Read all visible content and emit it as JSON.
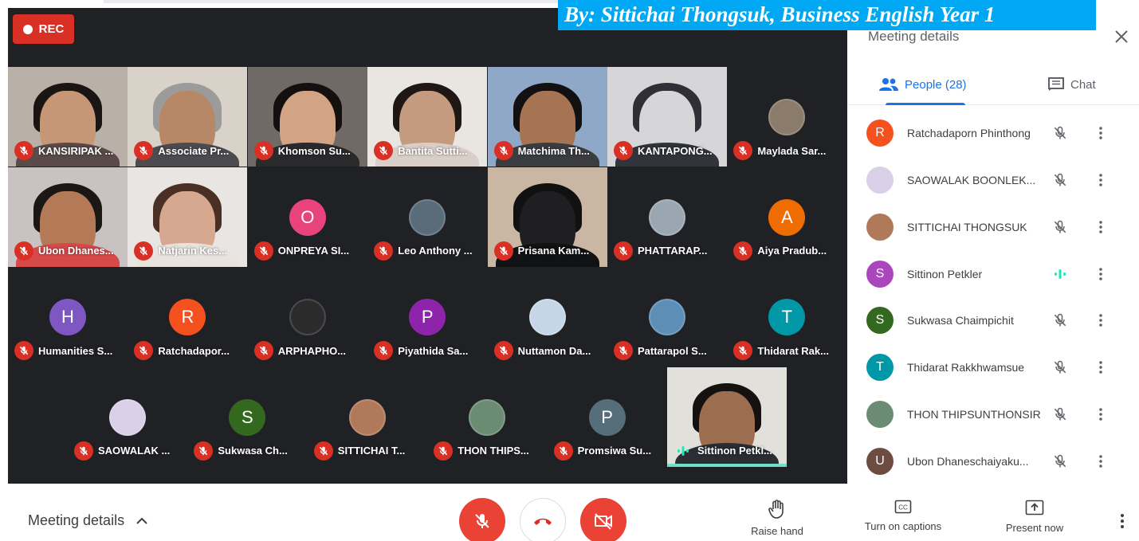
{
  "watermark": "By: Sittichai Thongsuk, Business English Year 1",
  "recording": {
    "label": "REC",
    "color": "#d93025"
  },
  "tiles": [
    {
      "name": "KANSIRIPAK ...",
      "kind": "video",
      "bg": "#b9b0a8",
      "skin": "#c59776",
      "hair": "#1a1412",
      "shirt": "#5a4a4a"
    },
    {
      "name": "Associate Pr...",
      "kind": "video",
      "bg": "#d8d2c8",
      "skin": "#b68868",
      "hair": "#9b9b9b",
      "shirt": "#4b4b50"
    },
    {
      "name": "Khomson Su...",
      "kind": "video",
      "bg": "#6f6a66",
      "skin": "#d2a384",
      "hair": "#151010",
      "shirt": "#2a2a2c"
    },
    {
      "name": "Bantita Sutti...",
      "kind": "video",
      "bg": "#e9e6e1",
      "skin": "#c59b7f",
      "hair": "#1f1713",
      "shirt": "#d9cfc8"
    },
    {
      "name": "Matchima Th...",
      "kind": "video",
      "bg": "#8fa8c8",
      "skin": "#a77453",
      "hair": "#121010",
      "shirt": "#3b3c40"
    },
    {
      "name": "KANTAPONG...",
      "kind": "video",
      "bg": "#d6d6d9",
      "skin": "#d6d6d9",
      "hair": "#2e3036",
      "shirt": "#31343b"
    },
    {
      "name": "Maylada Sar...",
      "kind": "avatar",
      "letter": "",
      "color": "#8a7b6a"
    },
    {
      "name": "Ubon Dhanes...",
      "kind": "video",
      "bg": "#c9c2c3",
      "skin": "#b47a58",
      "hair": "#1b1715",
      "shirt": "#d74a4a"
    },
    {
      "name": "Natjarin Kes...",
      "kind": "video",
      "bg": "#e8e5e3",
      "skin": "#d7a890",
      "hair": "#4a3024",
      "shirt": "#e9e3de"
    },
    {
      "name": "ONPREYA SI...",
      "kind": "avatar",
      "letter": "O",
      "color": "#e8437a"
    },
    {
      "name": "Leo Anthony ...",
      "kind": "avatar",
      "letter": "",
      "color": "#5a6b7a"
    },
    {
      "name": "Prisana Kam...",
      "kind": "video",
      "bg": "#c9b7a4",
      "skin": "#1f1f22",
      "hair": "#111",
      "shirt": "#111214"
    },
    {
      "name": "PHATTARAP...",
      "kind": "avatar",
      "letter": "",
      "color": "#9aa7b2"
    },
    {
      "name": "Aiya Pradub...",
      "kind": "avatar",
      "letter": "A",
      "color": "#ef6c00"
    },
    {
      "name": "Humanities S...",
      "kind": "avatar",
      "letter": "H",
      "color": "#7e57c2"
    },
    {
      "name": "Ratchadapor...",
      "kind": "avatar",
      "letter": "R",
      "color": "#f4511e"
    },
    {
      "name": "ARPHAPHO...",
      "kind": "avatar",
      "letter": "",
      "color": "#2b2b2b"
    },
    {
      "name": "Piyathida Sa...",
      "kind": "avatar",
      "letter": "P",
      "color": "#8e24aa"
    },
    {
      "name": "Nuttamon Da...",
      "kind": "avatar",
      "letter": "",
      "color": "#c7d6e6"
    },
    {
      "name": "Pattarapol S...",
      "kind": "avatar",
      "letter": "",
      "color": "#5d8fb6"
    },
    {
      "name": "Thidarat Rak...",
      "kind": "avatar",
      "letter": "T",
      "color": "#0097a7"
    },
    {
      "name": "SAOWALAK ...",
      "kind": "avatar",
      "letter": "",
      "color": "#d9cfe6"
    },
    {
      "name": "Sukwasa Ch...",
      "kind": "avatar",
      "letter": "S",
      "color": "#33691e"
    },
    {
      "name": "SITTICHAI T...",
      "kind": "avatar",
      "letter": "",
      "color": "#b07a5a"
    },
    {
      "name": "THON THIPS...",
      "kind": "avatar",
      "letter": "",
      "color": "#6b8b73"
    },
    {
      "name": "Promsiwa Su...",
      "kind": "avatar",
      "letter": "P",
      "color": "#546e7a"
    },
    {
      "name": "Sittinon Petkl...",
      "kind": "video",
      "bg": "#e2e0da",
      "skin": "#9c6d4e",
      "hair": "#141110",
      "shirt": "#2a2d33",
      "speaking": true
    }
  ],
  "panel": {
    "title": "Meeting details",
    "tab_people": "People (28)",
    "tab_chat": "Chat",
    "people": [
      {
        "name": "Ratchadaporn Phinthong",
        "letter": "R",
        "color": "#f4511e",
        "status": "muted"
      },
      {
        "name": "SAOWALAK BOONLEK...",
        "letter": "",
        "color": "#d9cfe6",
        "status": "muted"
      },
      {
        "name": "SITTICHAI THONGSUK",
        "letter": "",
        "color": "#b07a5a",
        "status": "muted"
      },
      {
        "name": "Sittinon Petkler",
        "letter": "S",
        "color": "#ab47bc",
        "status": "speaking"
      },
      {
        "name": "Sukwasa Chaimpichit",
        "letter": "S",
        "color": "#33691e",
        "status": "muted"
      },
      {
        "name": "Thidarat Rakkhwamsue",
        "letter": "T",
        "color": "#0097a7",
        "status": "muted"
      },
      {
        "name": "THON THIPSUNTHONSIRI",
        "letter": "",
        "color": "#6b8b73",
        "status": "muted"
      },
      {
        "name": "Ubon Dhaneschaiyaku...",
        "letter": "U",
        "color": "#6d4c41",
        "status": "muted"
      }
    ]
  },
  "bottombar": {
    "meeting_details": "Meeting details",
    "raise_hand": "Raise hand",
    "captions": "Turn on captions",
    "present": "Present now"
  },
  "colors": {
    "accent": "#1a73e8",
    "danger": "#ea4335",
    "speaking": "#1de9b6"
  }
}
